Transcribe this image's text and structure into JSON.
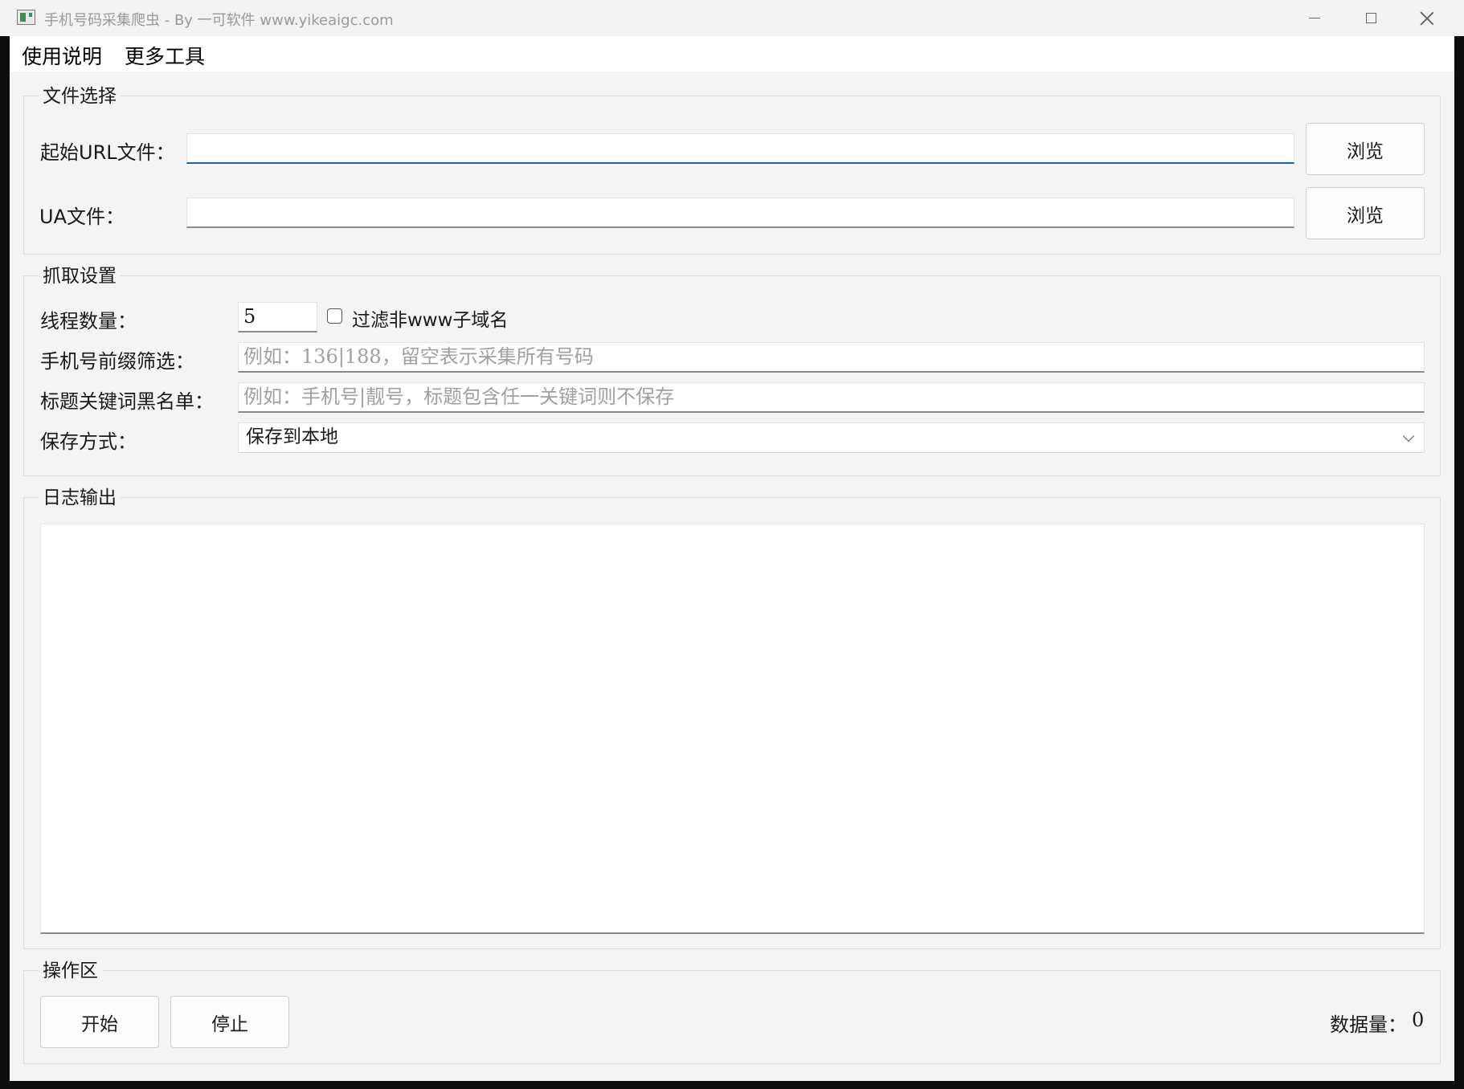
{
  "window": {
    "title": "手机号码采集爬虫 - By 一可软件 www.yikeaigc.com"
  },
  "menu": {
    "items": [
      "使用说明",
      "更多工具"
    ]
  },
  "file_group": {
    "title": "文件选择",
    "url_label": "起始URL文件：",
    "url_value": "",
    "ua_label": "UA文件：",
    "ua_value": "",
    "browse_label": "浏览"
  },
  "crawl_group": {
    "title": "抓取设置",
    "thread_label": "线程数量：",
    "thread_value": "5",
    "filter_checkbox_label": "过滤非www子域名",
    "filter_checked": false,
    "prefix_label": "手机号前缀筛选：",
    "prefix_placeholder": "例如：136|188，留空表示采集所有号码",
    "blacklist_label": "标题关键词黑名单：",
    "blacklist_placeholder": "例如：手机号|靓号，标题包含任一关键词则不保存",
    "save_label": "保存方式：",
    "save_value": "保存到本地"
  },
  "log_group": {
    "title": "日志输出"
  },
  "action_group": {
    "title": "操作区",
    "start_label": "开始",
    "stop_label": "停止",
    "count_label": "数据量：",
    "count_value": "0"
  }
}
